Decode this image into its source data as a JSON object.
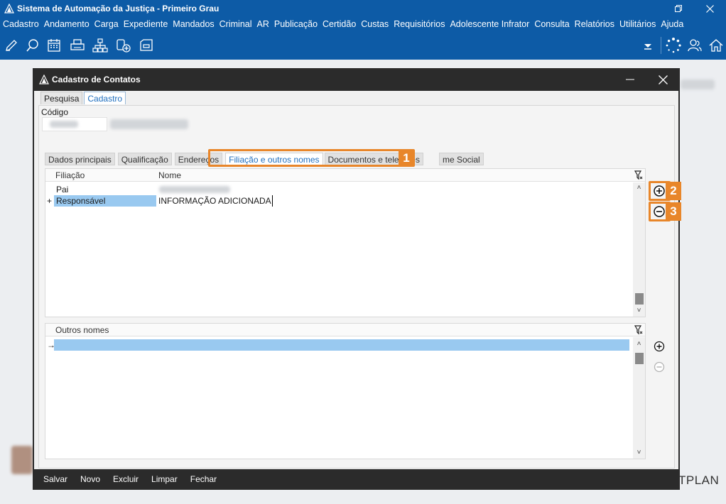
{
  "app": {
    "title": "Sistema de Automação da Justiça - Primeiro Grau",
    "menu": [
      "Cadastro",
      "Andamento",
      "Carga",
      "Expediente",
      "Mandados",
      "Criminal",
      "AR",
      "Publicação",
      "Certidão",
      "Custas",
      "Requisitórios",
      "Adolescente Infrator",
      "Consulta",
      "Relatórios",
      "Utilitários",
      "Ajuda"
    ],
    "toolbar_icons": [
      "edit-icon",
      "search-process-icon",
      "calendar-icon",
      "print-icon",
      "hierarchy-icon",
      "money-add-icon",
      "inbox-icon"
    ],
    "right_icons": [
      "dropdown-arrow-icon",
      "loading-icon",
      "users-icon",
      "home-icon"
    ]
  },
  "dialog": {
    "title": "Cadastro de Contatos",
    "top_tabs": [
      "Pesquisa",
      "Cadastro"
    ],
    "codigo_label": "Código",
    "subtabs": [
      "Dados principais",
      "Qualificação",
      "Endereços",
      "Filiação e outros nomes",
      "Documentos e telefones",
      "me Social"
    ],
    "filiacao_grid": {
      "columns": [
        "Filiação",
        "Nome"
      ],
      "rows": [
        {
          "filiacao": "Pai",
          "nome": ""
        },
        {
          "filiacao": "Responsável",
          "nome": "INFORMAÇÃO ADICIONADA"
        }
      ],
      "row_marker": "+"
    },
    "outros_grid": {
      "columns": [
        "Outros nomes"
      ],
      "row_marker": "→"
    },
    "footer_buttons": [
      "Salvar",
      "Novo",
      "Excluir",
      "Limpar",
      "Fechar"
    ]
  },
  "callouts": [
    "1",
    "2",
    "3"
  ],
  "brand": "TPLAN",
  "colors": {
    "titlebar": "#0d5ba6",
    "accent": "#e8862a",
    "selection": "#99c9f0"
  }
}
